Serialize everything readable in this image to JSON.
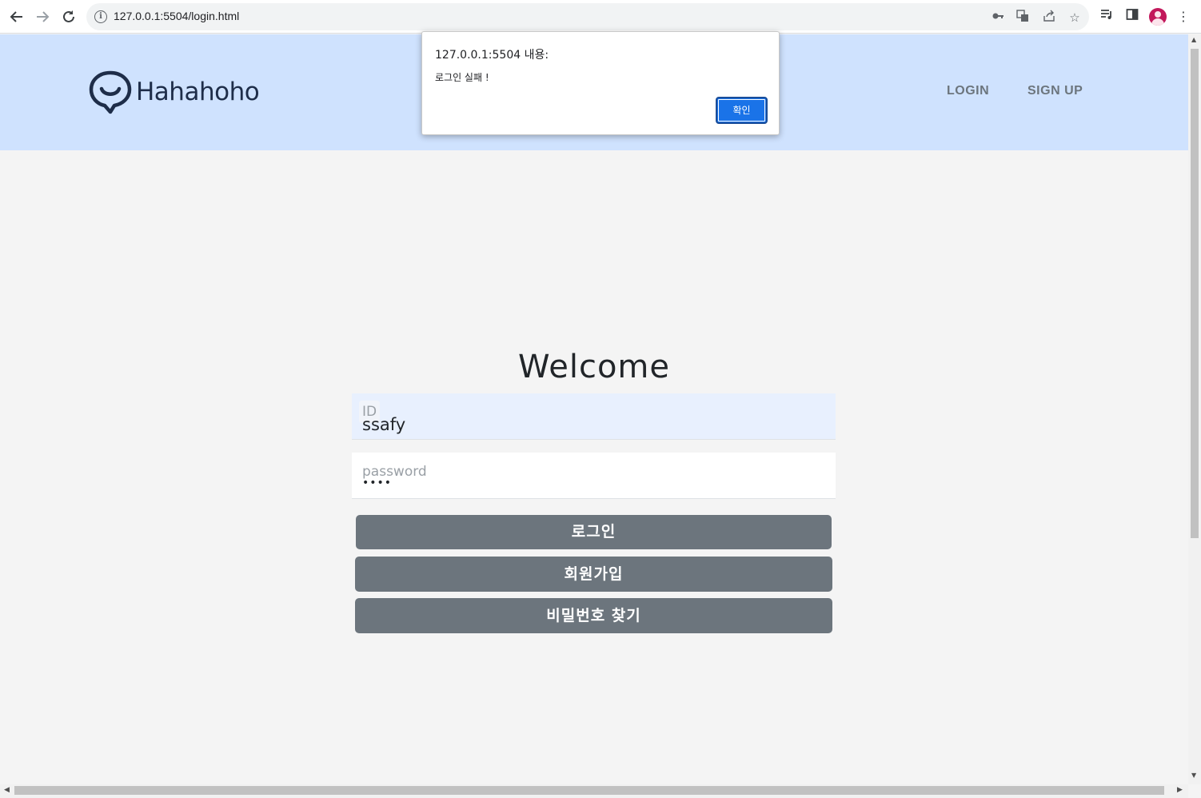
{
  "browser": {
    "url": "127.0.0.1:5504/login.html",
    "icons": {
      "back": "back-arrow-icon",
      "forward": "forward-arrow-icon",
      "reload": "reload-icon",
      "info": "info-icon",
      "key": "key-icon",
      "translate": "translate-icon",
      "share": "share-icon",
      "star": "bookmark-star-icon",
      "media": "media-queue-icon",
      "sidepanel": "side-panel-icon",
      "profile": "profile-avatar",
      "menu": "more-vert-icon"
    }
  },
  "header": {
    "logo_text": "Hahahoho",
    "nav": {
      "login": "LOGIN",
      "signup": "SIGN UP"
    },
    "background": "#cfe2fe"
  },
  "main": {
    "title": "Welcome",
    "id_field": {
      "label": "ID",
      "value": "ssafy"
    },
    "password_field": {
      "label": "password",
      "value": "••••"
    },
    "buttons": {
      "login": "로그인",
      "signup": "회원가입",
      "find_password": "비밀번호 찾기"
    }
  },
  "alert": {
    "title": "127.0.0.1:5504 내용:",
    "message": "로그인 실패 !",
    "ok_label": "확인"
  },
  "colors": {
    "button": "#6c757d",
    "alert_ok": "#1a73e8",
    "id_field_bg": "#e8f0fe"
  }
}
